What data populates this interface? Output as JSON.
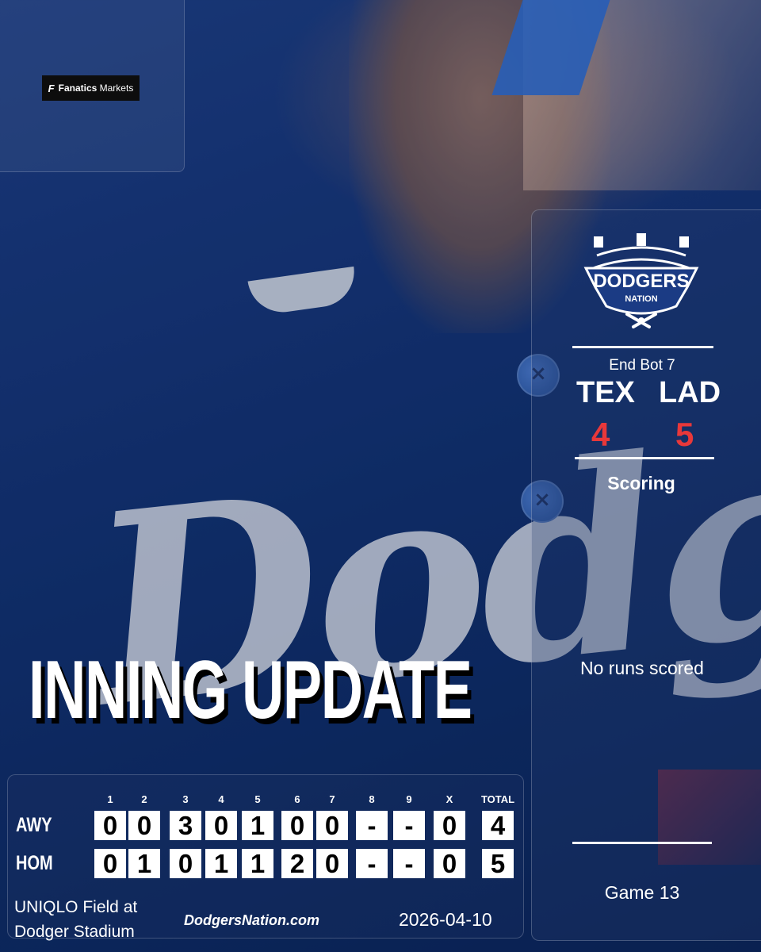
{
  "sponsor": {
    "brand_bold": "Fanatics",
    "brand_rest": "Markets"
  },
  "brand_logo": {
    "top_text": "DODGERS",
    "bottom_text": "NATION"
  },
  "scoreboard": {
    "status": "End Bot 7",
    "away_team": "TEX",
    "home_team": "LAD",
    "away_runs": "4",
    "home_runs": "5",
    "scoring_label": "Scoring",
    "scoring_text": "No runs scored",
    "game_label": "Game 13"
  },
  "headline": "INNING UPDATE",
  "linescore": {
    "headers": [
      "1",
      "2",
      "3",
      "4",
      "5",
      "6",
      "7",
      "8",
      "9",
      "X",
      "TOTAL"
    ],
    "rows": [
      {
        "label": "AWY",
        "cells": [
          "0",
          "0",
          "3",
          "0",
          "1",
          "0",
          "0",
          "-",
          "-",
          "0",
          "4"
        ]
      },
      {
        "label": "HOM",
        "cells": [
          "0",
          "1",
          "0",
          "1",
          "1",
          "2",
          "0",
          "-",
          "-",
          "0",
          "5"
        ]
      }
    ]
  },
  "footer": {
    "venue_line1": "UNIQLO Field at",
    "venue_line2": "Dodger Stadium",
    "site": "DodgersNation.com",
    "date": "2026-04-10"
  },
  "colors": {
    "background": "#143575",
    "accent_red": "#e8383a",
    "cell_bg": "#ffffff"
  }
}
